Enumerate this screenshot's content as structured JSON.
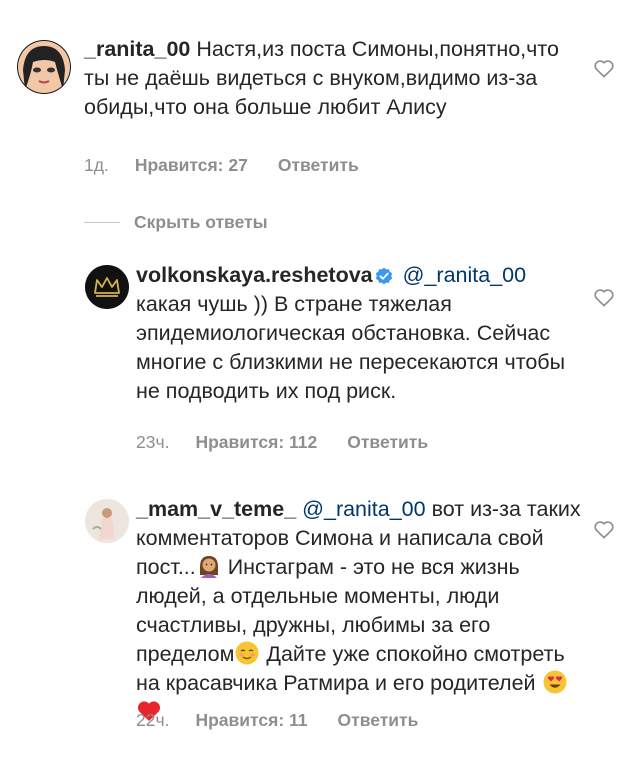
{
  "comments": [
    {
      "username": "_ranita_00",
      "text": "Настя,из поста Симоны,понятно,что ты не даёшь видеться с внуком,видимо из-за обиды,что она больше любит Алису",
      "time": "1д.",
      "likes": "Нравится: 27",
      "reply": "Ответить"
    },
    {
      "username": "volkonskaya.reshetova",
      "mention": "@_ranita_00",
      "text": "какая чушь )) В стране тяжелая эпидемиологическая обстановка. Сейчас многие с близкими не пересекаются чтобы не подводить их под риск.",
      "time": "23ч.",
      "likes": "Нравится: 112",
      "reply": "Ответить"
    },
    {
      "username": "_mam_v_teme_",
      "mention": "@_ranita_00",
      "text_1": "вот из-за таких комментаторов Симона и написала свой пост...",
      "text_2": "Инстаграм - это не вся жизнь людей, а отдельные моменты, люди счастливы, дружны, любимы за его пределом",
      "text_3": "Дайте уже спокойно смотреть на красавчика Ратмира и его родителей",
      "time": "22ч.",
      "likes": "Нравится: 11",
      "reply": "Ответить"
    }
  ],
  "hide_replies": "Скрыть ответы",
  "icons": {
    "like": "heart-outline-icon",
    "verified": "verified-badge-icon",
    "emoji_1": "woman-tipping-hand-emoji",
    "emoji_2": "smiling-face-emoji",
    "emoji_3": "heart-eyes-emoji",
    "emoji_4": "red-heart-emoji"
  },
  "colors": {
    "text": "#262626",
    "muted": "#8e8e8e",
    "mention": "#00376b",
    "verified": "#3897f0"
  }
}
